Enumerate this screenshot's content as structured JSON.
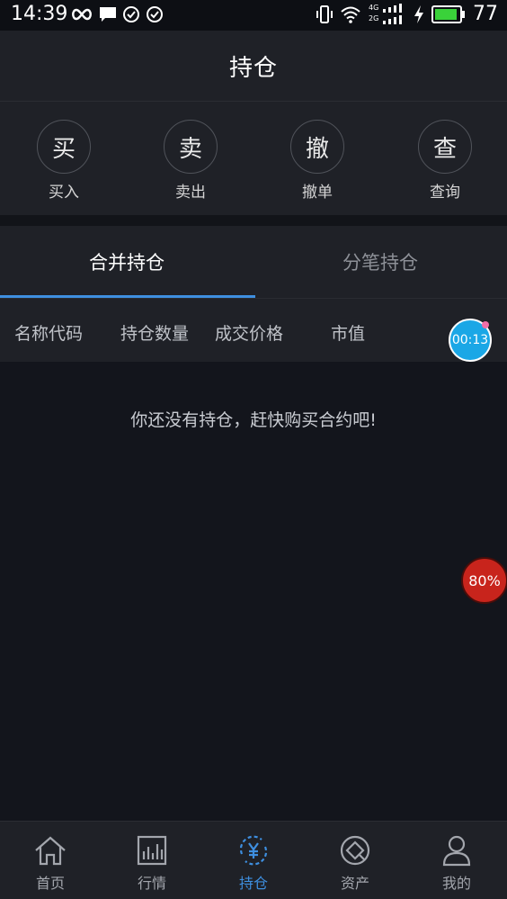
{
  "status_bar": {
    "time": "14:39",
    "battery": "77",
    "network_labels": [
      "4G",
      "2G"
    ]
  },
  "header": {
    "title": "持仓"
  },
  "actions": [
    {
      "glyph": "买",
      "label": "买入"
    },
    {
      "glyph": "卖",
      "label": "卖出"
    },
    {
      "glyph": "撤",
      "label": "撤单"
    },
    {
      "glyph": "查",
      "label": "查询"
    }
  ],
  "tabs": [
    {
      "label": "合并持仓",
      "active": true
    },
    {
      "label": "分笔持仓",
      "active": false
    }
  ],
  "columns": [
    "名称代码",
    "持仓数量",
    "成交价格",
    "市值"
  ],
  "empty_message": "你还没有持仓，赶快购买合约吧!",
  "overlays": {
    "timer": "00:13",
    "progress": "80%"
  },
  "bottom_nav": [
    {
      "label": "首页",
      "icon": "home-icon",
      "active": false
    },
    {
      "label": "行情",
      "icon": "chart-icon",
      "active": false
    },
    {
      "label": "持仓",
      "icon": "yen-cycle-icon",
      "active": true
    },
    {
      "label": "资产",
      "icon": "asset-icon",
      "active": false
    },
    {
      "label": "我的",
      "icon": "user-icon",
      "active": false
    }
  ],
  "colors": {
    "accent": "#3e8fe0",
    "background": "#13151c",
    "panel": "#1f2127"
  }
}
